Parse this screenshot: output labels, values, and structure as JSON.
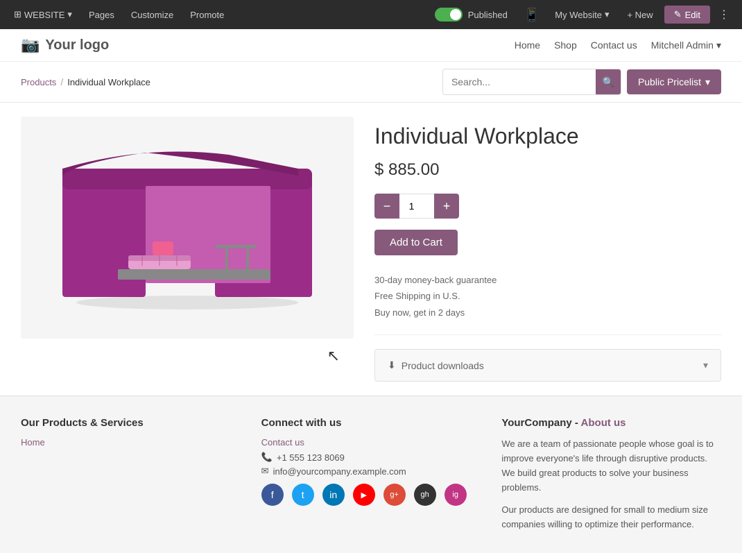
{
  "topbar": {
    "website_label": "WEBSITE",
    "pages_label": "Pages",
    "customize_label": "Customize",
    "promote_label": "Promote",
    "published_label": "Published",
    "my_website_label": "My Website",
    "new_label": "+ New",
    "edit_label": "Edit",
    "is_published": true
  },
  "header": {
    "logo_text": "Your logo",
    "nav": {
      "home": "Home",
      "shop": "Shop",
      "contact_us": "Contact us",
      "user": "Mitchell Admin"
    }
  },
  "breadcrumb": {
    "products": "Products",
    "current": "Individual Workplace"
  },
  "search": {
    "placeholder": "Search...",
    "pricelist_label": "Public Pricelist"
  },
  "product": {
    "title": "Individual Workplace",
    "price": "$ 885.00",
    "quantity": 1,
    "add_to_cart_label": "Add to Cart",
    "guarantee": "30-day money-back guarantee",
    "shipping": "Free Shipping in U.S.",
    "delivery": "Buy now, get in 2 days",
    "downloads_label": "Product downloads"
  },
  "footer": {
    "col1": {
      "title": "Our Products & Services",
      "home_link": "Home"
    },
    "col2": {
      "title": "Connect with us",
      "contact_link": "Contact us",
      "phone": "+1 555 123 8069",
      "email": "info@yourcompany.example.com",
      "social": {
        "facebook": "f",
        "twitter": "t",
        "linkedin": "in",
        "youtube": "▶",
        "google": "g+",
        "github": "gh",
        "instagram": "ig"
      }
    },
    "col3": {
      "company_name": "YourCompany",
      "separator": " - ",
      "about_link": "About us",
      "description1": "We are a team of passionate people whose goal is to improve everyone's life through disruptive products. We build great products to solve your business problems.",
      "description2": "Our products are designed for small to medium size companies willing to optimize their performance."
    }
  },
  "colors": {
    "accent": "#875a7b",
    "accent_hover": "#7a5070",
    "toggle_on": "#4CAF50"
  }
}
